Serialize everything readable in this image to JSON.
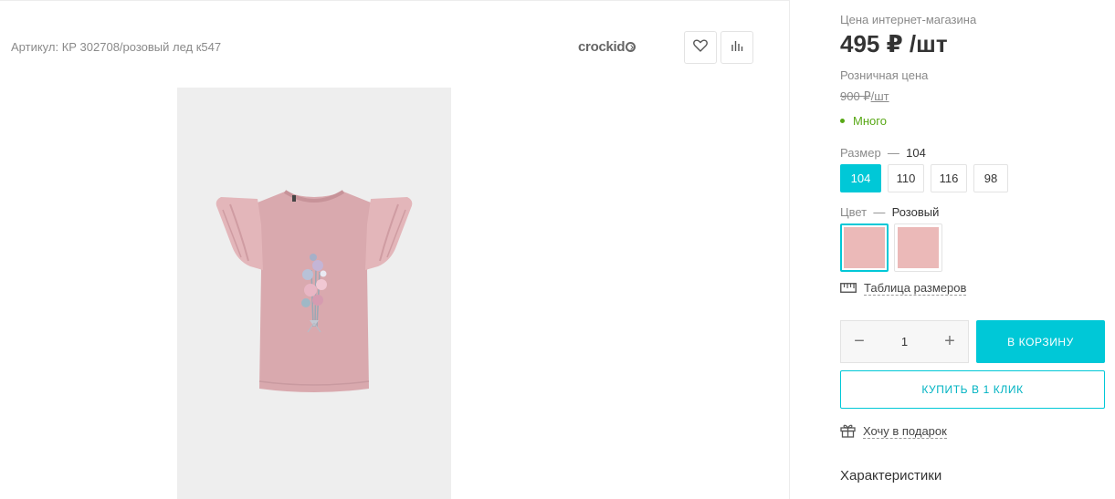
{
  "product": {
    "article": "Артикул: КР 302708/розовый лед к547",
    "brand": "crockid",
    "favorite_icon": "heart-icon",
    "compare_icon": "bar-chart-icon"
  },
  "pricing": {
    "online_label": "Цена интернет-магазина",
    "online_price": "495 ₽ /шт",
    "retail_label": "Розничная цена",
    "retail_price": "900 ₽",
    "retail_unit": "/шт",
    "stock": "Много",
    "stock_color": "#58a816"
  },
  "size": {
    "label": "Размер",
    "dash": "—",
    "selected": "104",
    "options": [
      "104",
      "110",
      "116",
      "98"
    ]
  },
  "color": {
    "label": "Цвет",
    "dash": "—",
    "selected": "Розовый",
    "swatches": [
      "#ebb9b8",
      "#ebb9b8"
    ]
  },
  "links": {
    "size_table": "Таблица размеров",
    "gift": "Хочу в подарок"
  },
  "cart": {
    "quantity": "1",
    "add_to_cart": "В КОРЗИНУ",
    "buy_one_click": "КУПИТЬ В 1 КЛИК"
  },
  "characteristics": "Характеристики",
  "colors": {
    "accent": "#00c8d7",
    "garment": "#d9a9ae"
  }
}
